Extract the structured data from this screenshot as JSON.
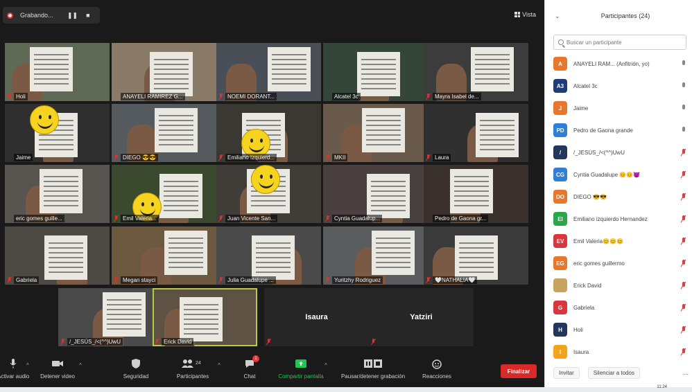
{
  "recording": {
    "label": "Grabando...",
    "pause_icon": "pause-icon",
    "stop_icon": "stop-icon"
  },
  "view": {
    "label": "Vista",
    "icon": "grid-icon"
  },
  "tiles": [
    {
      "name": "Holi",
      "muted": true
    },
    {
      "name": "ANAYELI RAMIREZ G...",
      "muted": false
    },
    {
      "name": "NOEMI DORANT...",
      "muted": true
    },
    {
      "name": "Alcatel 3c",
      "muted": false
    },
    {
      "name": "Mayra Isabel de...",
      "muted": true
    },
    {
      "name": "Jaime",
      "muted": false
    },
    {
      "name": "DIEGO 😎😎",
      "muted": true
    },
    {
      "name": "Emiliano Izquierd...",
      "muted": true
    },
    {
      "name": "MKII",
      "muted": true
    },
    {
      "name": "Laura",
      "muted": true
    },
    {
      "name": "eric gomes guille...",
      "muted": false
    },
    {
      "name": "Emil Valeria...",
      "muted": true
    },
    {
      "name": "Juan Vicente San...",
      "muted": true
    },
    {
      "name": "Cyntia Guadalup...",
      "muted": true
    },
    {
      "name": "Pedro de Gaona gr...",
      "muted": false
    },
    {
      "name": "Gabriela",
      "muted": true
    },
    {
      "name": "Megan stayci",
      "muted": true
    },
    {
      "name": "Julia Guadalupe ...",
      "muted": true
    },
    {
      "name": "Yuritzhy Rodriguez",
      "muted": true
    },
    {
      "name": "🤍NATHALIA🤍",
      "muted": true
    },
    {
      "name": "/_JESÚS_/<(^^)UwU",
      "muted": true
    },
    {
      "name": "Erick David",
      "muted": true
    },
    {
      "name": "Isaura",
      "muted": true,
      "video_off": true
    },
    {
      "name": "Yatziri",
      "muted": true,
      "video_off": true
    }
  ],
  "toolbar": {
    "audio": "Activar audio",
    "video": "Detener video",
    "security": "Seguridad",
    "participants": "Participantes",
    "participants_count": "24",
    "chat": "Chat",
    "chat_badge": "1",
    "share": "Compartir pantalla",
    "record": "Pausar/detener grabación",
    "reactions": "Reacciones",
    "end": "Finalizar"
  },
  "panel": {
    "title": "Participantes (24)",
    "search_placeholder": "Buscar un participante",
    "invite": "Invitar",
    "mute_all": "Silenciar a todos",
    "more": "..."
  },
  "participants": [
    {
      "initials": "A",
      "name": "ANAYELI RAM... (Anfitrión, yo)",
      "color": "#e8772e",
      "muted": false
    },
    {
      "initials": "A3",
      "name": "Alcatel 3c",
      "color": "#1f3b78",
      "muted": false
    },
    {
      "initials": "J",
      "name": "Jaime",
      "color": "#e8772e",
      "muted": false
    },
    {
      "initials": "PD",
      "name": "Pedro de Gaona grande",
      "color": "#2f7fd6",
      "muted": false
    },
    {
      "initials": "/",
      "name": "/_JESÚS_/<(^^)UwU",
      "color": "#23365e",
      "muted": true
    },
    {
      "initials": "CG",
      "name": "Cyntia Guadalupe 😊😊😈",
      "color": "#2f7fd6",
      "muted": true
    },
    {
      "initials": "DO",
      "name": "DIEGO 😎😎",
      "color": "#e8772e",
      "muted": true
    },
    {
      "initials": "EI",
      "name": "Emiliano izquierdo Hernandez",
      "color": "#2da54a",
      "muted": true
    },
    {
      "initials": "EV",
      "name": "Emil Valeria😊😊😊",
      "color": "#d9363e",
      "muted": true
    },
    {
      "initials": "EG",
      "name": "eric gomes guillermo",
      "color": "#e8772e",
      "muted": true
    },
    {
      "initials": "",
      "name": "Erick David",
      "color": "#c9a25c",
      "muted": true
    },
    {
      "initials": "G",
      "name": "Gabriela",
      "color": "#d9363e",
      "muted": true
    },
    {
      "initials": "H",
      "name": "Holi",
      "color": "#23365e",
      "muted": true
    },
    {
      "initials": "I",
      "name": "Isaura",
      "color": "#f2a51a",
      "muted": true
    }
  ],
  "clock": "11:24"
}
